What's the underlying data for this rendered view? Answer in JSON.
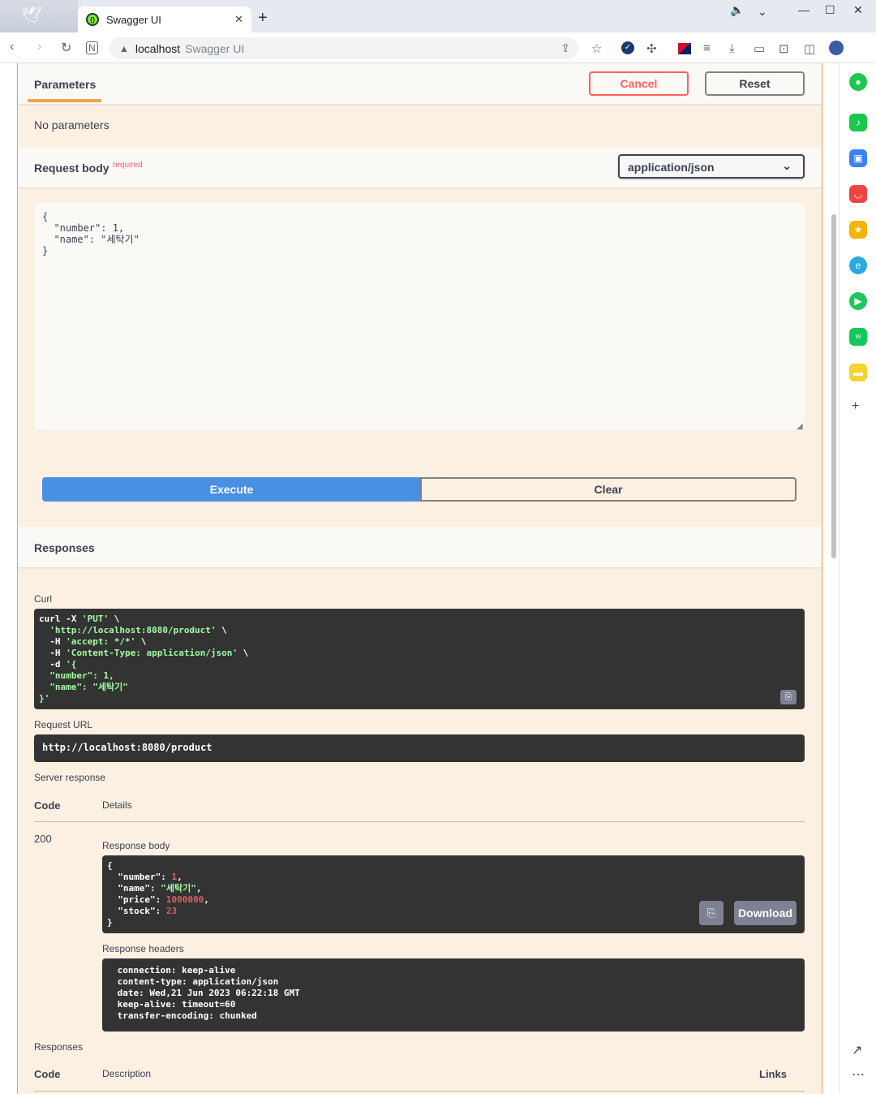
{
  "browser": {
    "tab_title": "Swagger UI",
    "address_host": "localhost",
    "address_title": "Swagger UI"
  },
  "parameters": {
    "tab_label": "Parameters",
    "cancel_label": "Cancel",
    "reset_label": "Reset",
    "empty_text": "No parameters"
  },
  "request_body": {
    "title": "Request body",
    "required_label": "required",
    "content_type": "application/json",
    "editor_text": "{\n  \"number\": 1,\n  \"name\": \"세탁기\"\n}"
  },
  "actions": {
    "execute_label": "Execute",
    "clear_label": "Clear"
  },
  "responses": {
    "title": "Responses",
    "curl_label": "Curl",
    "curl_lines": [
      {
        "plain": "curl -X ",
        "str": "'PUT'",
        "tail": " \\"
      },
      {
        "plain": "  ",
        "str": "'http://localhost:8080/product'",
        "tail": " \\"
      },
      {
        "plain": "  -H ",
        "str": "'accept: */*'",
        "tail": " \\"
      },
      {
        "plain": "  -H ",
        "str": "'Content-Type: application/json'",
        "tail": " \\"
      },
      {
        "plain": "  -d ",
        "str": "'{",
        "tail": ""
      },
      {
        "plain": "",
        "str": "  \"number\": 1,",
        "tail": ""
      },
      {
        "plain": "",
        "str": "  \"name\": \"세탁기\"",
        "tail": ""
      },
      {
        "plain": "",
        "str": "}'",
        "tail": ""
      }
    ],
    "request_url_label": "Request URL",
    "request_url": "http://localhost:8080/product",
    "server_response_label": "Server response",
    "code_header": "Code",
    "details_header": "Details",
    "status_code": "200",
    "response_body_label": "Response body",
    "response_body": [
      {
        "key": "",
        "val": "{",
        "type": "plain",
        "sep": ""
      },
      {
        "key": "  \"number\": ",
        "val": "1",
        "type": "num",
        "sep": ","
      },
      {
        "key": "  \"name\": ",
        "val": "\"세탁기\"",
        "type": "str",
        "sep": ","
      },
      {
        "key": "  \"price\": ",
        "val": "1000000",
        "type": "num",
        "sep": ","
      },
      {
        "key": "  \"stock\": ",
        "val": "23",
        "type": "num",
        "sep": ""
      },
      {
        "key": "",
        "val": "}",
        "type": "plain",
        "sep": ""
      }
    ],
    "download_label": "Download",
    "response_headers_label": "Response headers",
    "response_headers": " connection: keep-alive \n content-type: application/json \n date: Wed,21 Jun 2023 06:22:18 GMT \n keep-alive: timeout=60 \n transfer-encoding: chunked ",
    "responses_label": "Responses",
    "description_header": "Description",
    "links_header": "Links"
  }
}
